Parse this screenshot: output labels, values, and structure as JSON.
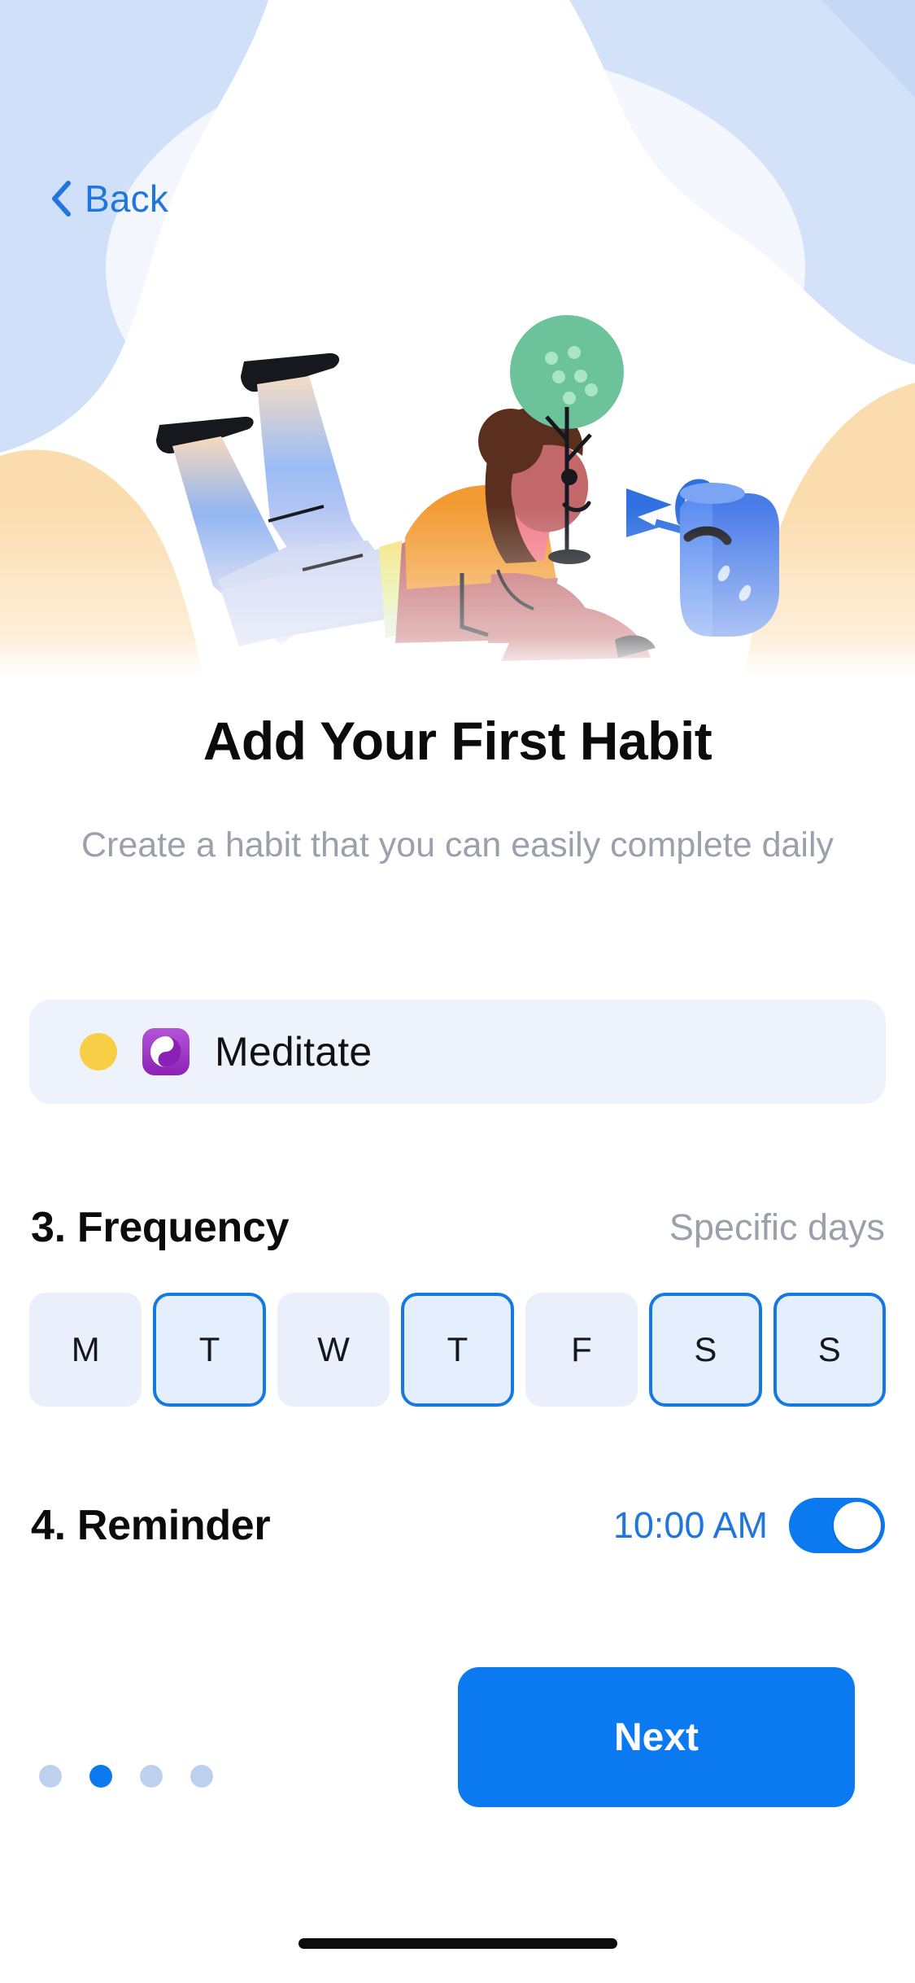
{
  "nav": {
    "back_label": "Back",
    "back_icon": "chevron-left-icon"
  },
  "hero": {
    "illustration_alt": "person sitting beside a tree with a watering can",
    "blob_blue": "#cfe0f8",
    "blob_orange": "#fbd9a8"
  },
  "header": {
    "title": "Add Your First Habit",
    "subtitle": "Create a habit that you can easily complete daily"
  },
  "habit": {
    "color_dot": "#F8CE46",
    "emoji_icon": "yin-yang-icon",
    "emoji_bg": "#9B2FBF",
    "name": "Meditate"
  },
  "frequency": {
    "title": "3. Frequency",
    "value": "Specific days",
    "days": [
      {
        "label": "M",
        "selected": false
      },
      {
        "label": "T",
        "selected": true
      },
      {
        "label": "W",
        "selected": false
      },
      {
        "label": "T",
        "selected": true
      },
      {
        "label": "F",
        "selected": false
      },
      {
        "label": "S",
        "selected": true
      },
      {
        "label": "S",
        "selected": true
      }
    ]
  },
  "reminder": {
    "title": "4. Reminder",
    "time": "10:00 AM",
    "enabled": true
  },
  "footer": {
    "next_label": "Next",
    "pagination": {
      "total": 4,
      "active_index": 1
    }
  },
  "colors": {
    "accent": "#0B79F0",
    "link": "#2176DE",
    "muted": "#9aa1ab",
    "chip_bg": "#eaf0fb",
    "card_bg": "#eef2fb"
  }
}
